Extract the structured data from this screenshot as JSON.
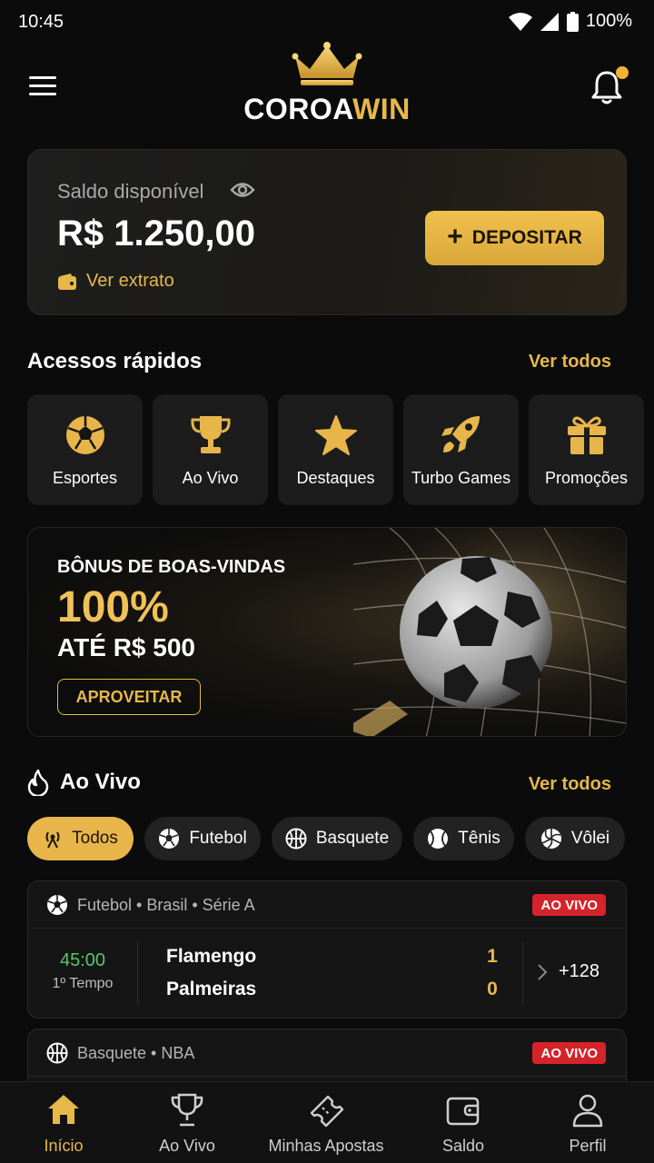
{
  "status_bar": {
    "time": "10:45",
    "battery": "100%"
  },
  "header": {
    "brand_white": "COROA",
    "brand_gold": "WIN",
    "notification_dot": true
  },
  "balance": {
    "label": "Saldo disponível",
    "value": "R$ 1.250,00",
    "statement_link": "Ver extrato",
    "deposit_label": "DEPOSITAR"
  },
  "quick_access": {
    "title": "Acessos rápidos",
    "see_all": "Ver todos",
    "items": [
      {
        "label": "Esportes",
        "icon": "soccer-ball-icon"
      },
      {
        "label": "Ao Vivo",
        "icon": "trophy-icon"
      },
      {
        "label": "Destaques",
        "icon": "star-icon"
      },
      {
        "label": "Turbo Games",
        "icon": "rocket-icon"
      },
      {
        "label": "Promoções",
        "icon": "gift-icon"
      }
    ]
  },
  "promo": {
    "kicker": "BÔNUS DE BOAS-VINDAS",
    "headline": "100%",
    "sub": "ATÉ R$ 500",
    "cta": "APROVEITAR"
  },
  "live": {
    "title": "Ao Vivo",
    "see_all": "Ver todos",
    "filters": [
      {
        "label": "Todos",
        "icon": "broadcast-icon",
        "active": true
      },
      {
        "label": "Futebol",
        "icon": "soccer-ball-icon",
        "active": false
      },
      {
        "label": "Basquete",
        "icon": "basketball-icon",
        "active": false
      },
      {
        "label": "Tênis",
        "icon": "tennis-ball-icon",
        "active": false
      },
      {
        "label": "Vôlei",
        "icon": "volleyball-icon",
        "active": false
      }
    ],
    "matches": [
      {
        "league": "Futebol • Brasil • Série A",
        "badge": "AO VIVO",
        "clock": "45:00",
        "period": "1º Tempo",
        "home": "Flamengo",
        "away": "Palmeiras",
        "home_score": "1",
        "away_score": "0",
        "more_markets": "+128"
      },
      {
        "league": "Basquete • NBA",
        "badge": "AO VIVO"
      }
    ]
  },
  "bottom_nav": {
    "items": [
      {
        "label": "Início",
        "icon": "home-icon",
        "active": true
      },
      {
        "label": "Ao Vivo",
        "icon": "trophy-icon",
        "active": false
      },
      {
        "label": "Minhas Apostas",
        "icon": "ticket-icon",
        "active": false
      },
      {
        "label": "Saldo",
        "icon": "wallet-icon",
        "active": false
      },
      {
        "label": "Perfil",
        "icon": "user-icon",
        "active": false
      }
    ]
  },
  "colors": {
    "accent": "#e6b84a",
    "background": "#0b0b0b",
    "live_red": "#d4232a",
    "clock_green": "#58c56b"
  }
}
